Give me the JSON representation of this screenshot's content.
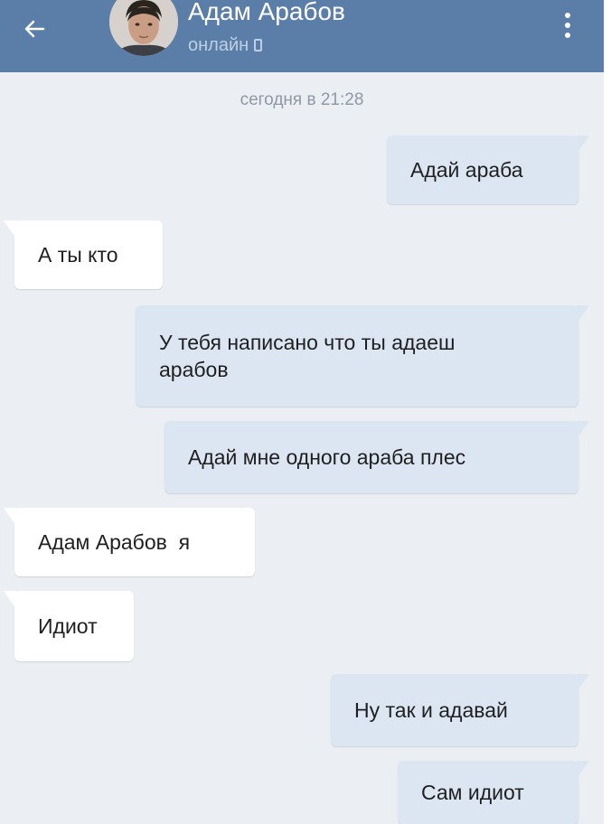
{
  "header": {
    "title": "Адам Арабов",
    "status": "онлайн",
    "back_icon": "arrow-left-icon",
    "menu_icon": "more-vertical-icon",
    "background": "#5b7ea8"
  },
  "chat": {
    "date_separator": "сегодня в 21:28",
    "messages": [
      {
        "direction": "out",
        "text": "Адай араба"
      },
      {
        "direction": "in",
        "text": "А ты кто"
      },
      {
        "direction": "out",
        "line1": "У тебя написано что ты адаеш",
        "line2": "арабов"
      },
      {
        "direction": "out",
        "text": "Адай мне одного араба плес"
      },
      {
        "direction": "in",
        "text": "Адам Арабов  я"
      },
      {
        "direction": "in",
        "text": "Идиот"
      },
      {
        "direction": "out",
        "text": "Ну так и адавай"
      },
      {
        "direction": "out",
        "text": "Сам идиот"
      }
    ]
  },
  "colors": {
    "outgoing_bubble": "#dce6f2",
    "incoming_bubble": "#ffffff",
    "chat_background": "#ebeef2"
  }
}
